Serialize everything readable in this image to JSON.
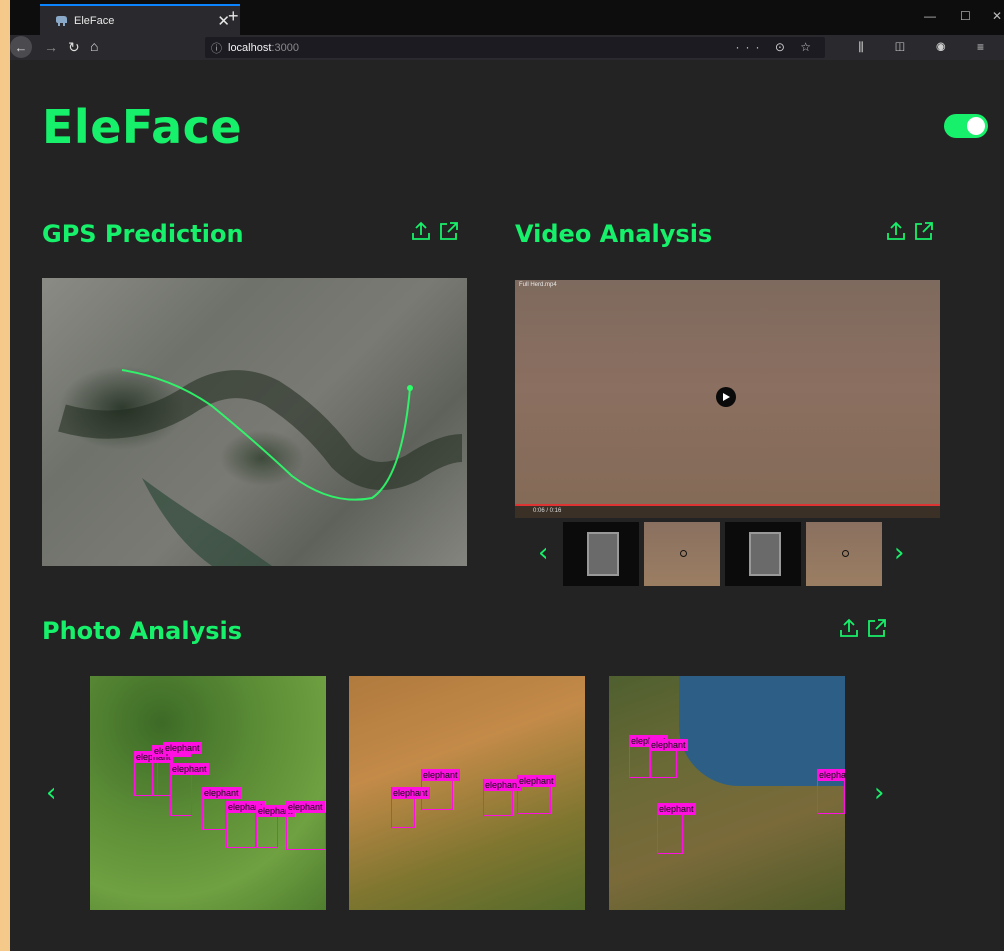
{
  "browser": {
    "tab_title": "EleFace",
    "tab_close": "✕",
    "new_tab": "+",
    "url_info": "ⓘ",
    "url_host": "localhost",
    "url_port": ":3000",
    "url_actions": "··· ⊙ ☆",
    "toolbar_icons": "⫼ ◫ ◉ ≡",
    "window_controls": {
      "minimize": "—",
      "maximize": "☐",
      "close": "✕"
    },
    "nav": {
      "back": "←",
      "forward": "→",
      "reload": "↻",
      "home": "⌂"
    }
  },
  "app": {
    "brand": "EleFace",
    "theme_toggle_on": true,
    "accent_color": "#17f06a"
  },
  "sections": {
    "gps": {
      "title": "GPS Prediction",
      "icons": [
        "upload-icon",
        "open-external-icon"
      ]
    },
    "video": {
      "title": "Video Analysis",
      "icons": [
        "upload-icon",
        "open-external-icon"
      ],
      "filename": "Full Herd.mp4",
      "time": "0:06 / 0:16"
    },
    "photo": {
      "title": "Photo Analysis",
      "icons": [
        "upload-icon",
        "open-external-icon"
      ]
    }
  },
  "carousel": {
    "prev": "‹",
    "next": "›"
  },
  "detections": {
    "label": "elephant",
    "photo1": [
      "elephant",
      "elephant",
      "elephant",
      "elephant",
      "elephant",
      "elephant",
      "elephant",
      "elephant"
    ],
    "photo2": [
      "elephant",
      "elephant",
      "elephant",
      "elephant"
    ],
    "photo3": [
      "elephant",
      "elephant",
      "elephant",
      "elephant"
    ]
  }
}
